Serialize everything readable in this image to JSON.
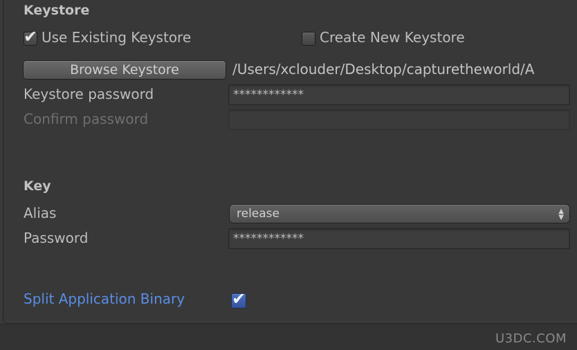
{
  "keystore": {
    "title": "Keystore",
    "use_existing_label": "Use Existing Keystore",
    "use_existing_checked": true,
    "create_new_label": "Create New Keystore",
    "create_new_checked": false,
    "browse_label": "Browse Keystore",
    "path": "/Users/xclouder/Desktop/capturetheworld/A",
    "password_label": "Keystore password",
    "password_value": "************",
    "confirm_label": "Confirm password",
    "confirm_value": ""
  },
  "key": {
    "title": "Key",
    "alias_label": "Alias",
    "alias_value": "release",
    "password_label": "Password",
    "password_value": "************"
  },
  "split": {
    "label": "Split Application Binary",
    "checked": true
  },
  "watermark": "U3DC.COM",
  "icons": {
    "check": "check-icon",
    "select_arrows": "up-down-arrows-icon"
  },
  "colors": {
    "link": "#5a8ee6",
    "panel": "#383838"
  }
}
